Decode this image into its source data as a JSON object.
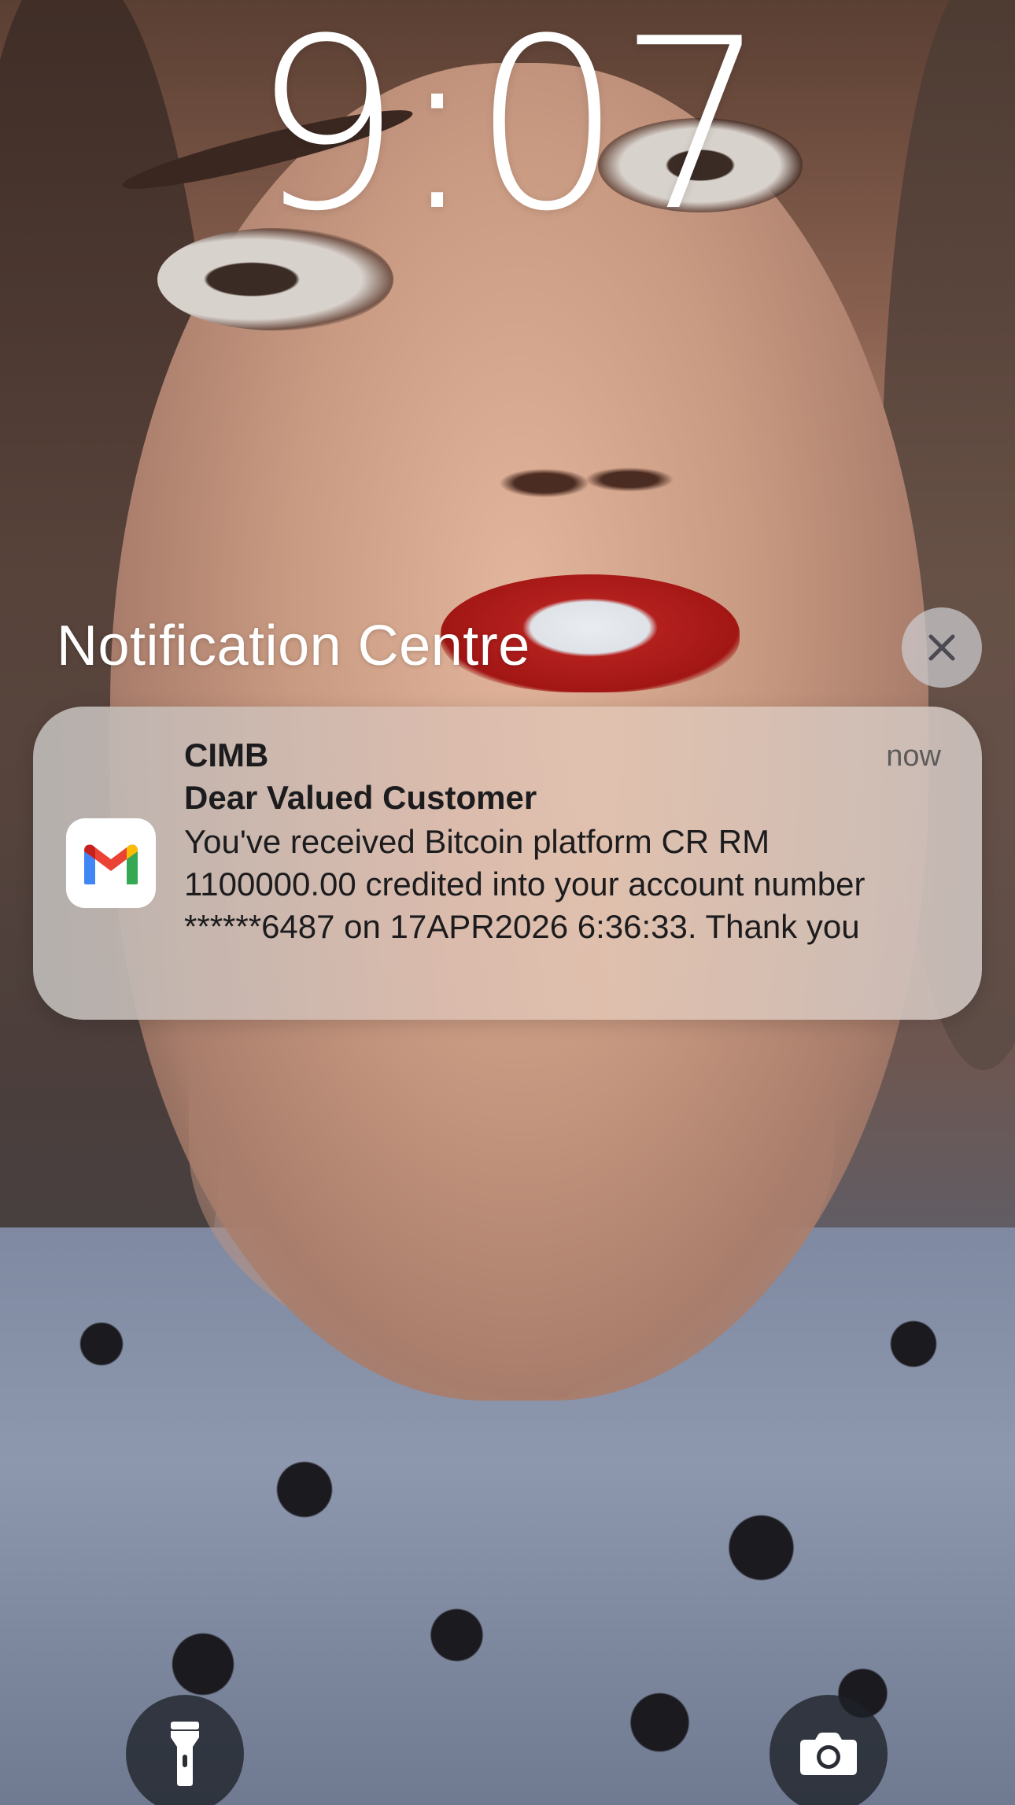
{
  "lock_screen": {
    "time": "9:07"
  },
  "notification_centre": {
    "title": "Notification Centre",
    "close_icon": "close-icon"
  },
  "notification": {
    "app_icon": "gmail-icon",
    "sender": "CIMB",
    "time": "now",
    "subject": "Dear Valued Customer",
    "body": "You've received Bitcoin platform CR RM 1100000.00 credited into your account number ******6487 on 17APR2026 6:36:33. Thank you"
  },
  "quick_actions": {
    "flashlight_icon": "flashlight-icon",
    "camera_icon": "camera-icon"
  },
  "colors": {
    "gmail_red": "#EA4335",
    "gmail_blue": "#4285F4",
    "gmail_green": "#34A853",
    "gmail_yellow": "#FBBC04",
    "gmail_dark_red": "#C5221F"
  }
}
